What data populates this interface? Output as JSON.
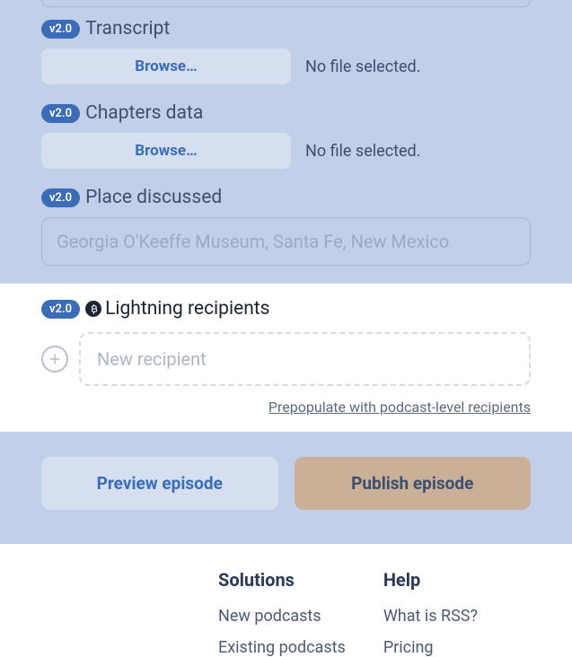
{
  "badges": {
    "version": "v2.0"
  },
  "fields": {
    "transcript": {
      "label": "Transcript",
      "browse": "Browse…",
      "status": "No file selected."
    },
    "chapters": {
      "label": "Chapters data",
      "browse": "Browse…",
      "status": "No file selected."
    },
    "place": {
      "label": "Place discussed",
      "placeholder": "Georgia O'Keeffe Museum, Santa Fe, New Mexico"
    },
    "lightning": {
      "label": "Lightning recipients",
      "placeholder": "New recipient",
      "prepopulate": "Prepopulate with podcast-level recipients"
    }
  },
  "actions": {
    "preview": "Preview episode",
    "publish": "Publish episode"
  },
  "footer": {
    "solutions": {
      "heading": "Solutions",
      "links": [
        "New podcasts",
        "Existing podcasts"
      ]
    },
    "help": {
      "heading": "Help",
      "links": [
        "What is RSS?",
        "Pricing"
      ]
    }
  }
}
